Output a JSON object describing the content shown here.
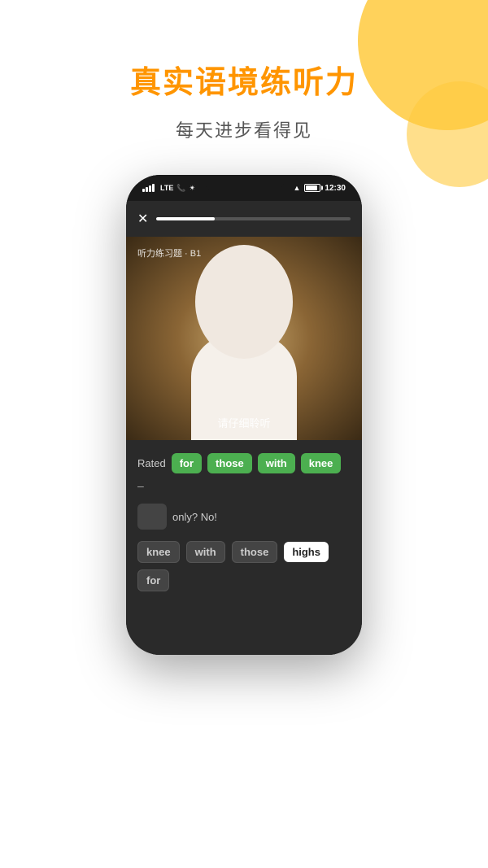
{
  "background": {
    "circle_color": "#FFCA3E"
  },
  "header": {
    "main_title": "真实语境练听力",
    "sub_title": "每天进步看得见"
  },
  "phone": {
    "status_bar": {
      "signal": "signal",
      "lte": "LTE",
      "time": "12:30"
    },
    "top_bar": {
      "close_label": "✕"
    },
    "video": {
      "label": "听力练习题 · B1",
      "listen_prompt": "请仔细聆听"
    },
    "sentence": {
      "rated_label": "Rated",
      "words": [
        "for",
        "those",
        "with",
        "knee"
      ],
      "dash": "–",
      "blank": "",
      "only_no": "only?  No!"
    },
    "options": {
      "words": [
        "knee",
        "with",
        "those",
        "highs",
        "for"
      ]
    }
  }
}
